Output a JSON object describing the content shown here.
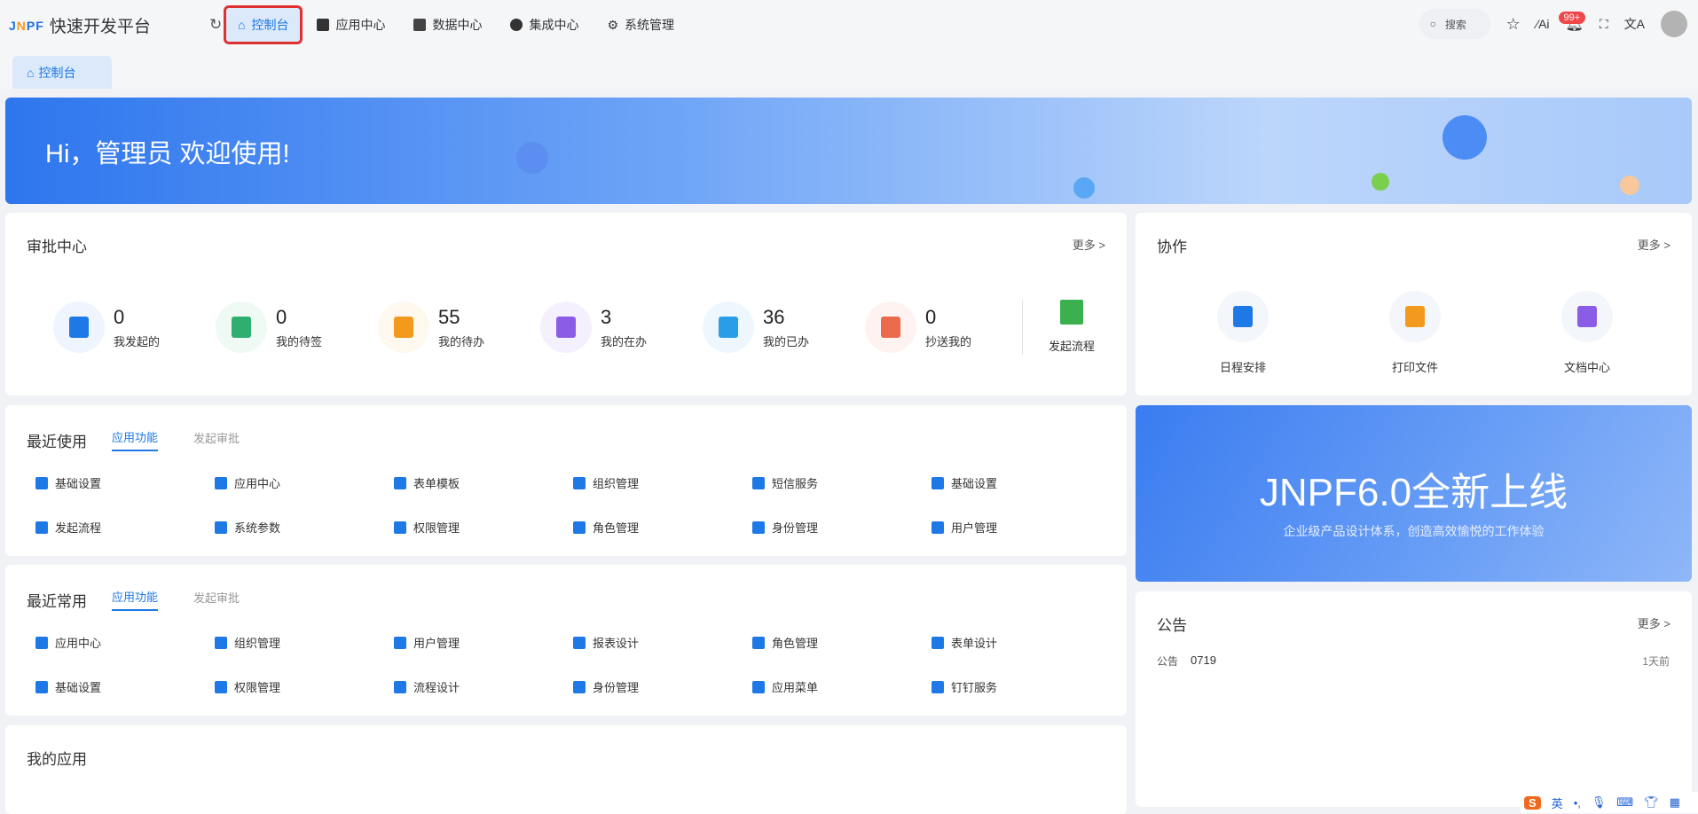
{
  "header": {
    "logo_mark": "JNPF",
    "title": "快速开发平台",
    "nav": [
      {
        "label": "控制台",
        "icon": "home-icon"
      },
      {
        "label": "应用中心",
        "icon": "grid-icon"
      },
      {
        "label": "数据中心",
        "icon": "database-icon"
      },
      {
        "label": "集成中心",
        "icon": "integration-icon"
      },
      {
        "label": "系统管理",
        "icon": "gear-icon"
      }
    ],
    "search_placeholder": "搜索",
    "badge": "99+"
  },
  "tabs": [
    {
      "label": "控制台"
    }
  ],
  "banner": {
    "greeting": "Hi，管理员 欢迎使用!"
  },
  "approval": {
    "title": "审批中心",
    "more": "更多 >",
    "stats": [
      {
        "value": "0",
        "label": "我发起的",
        "color": "#1e78e6",
        "bg": "#eef5fe"
      },
      {
        "value": "0",
        "label": "我的待签",
        "color": "#2fae6f",
        "bg": "#eefaf3"
      },
      {
        "value": "55",
        "label": "我的待办",
        "color": "#f39a1e",
        "bg": "#fef8ee"
      },
      {
        "value": "3",
        "label": "我的在办",
        "color": "#8b5ce6",
        "bg": "#f5f0fe"
      },
      {
        "value": "36",
        "label": "我的已办",
        "color": "#2a9de9",
        "bg": "#eef7fe"
      },
      {
        "value": "0",
        "label": "抄送我的",
        "color": "#ec6a4c",
        "bg": "#fef3f0"
      }
    ],
    "start_flow": "发起流程"
  },
  "coop": {
    "title": "协作",
    "more": "更多 >",
    "items": [
      {
        "label": "日程安排",
        "color": "#1e78e6"
      },
      {
        "label": "打印文件",
        "color": "#f39a1e"
      },
      {
        "label": "文档中心",
        "color": "#8b5ce6"
      }
    ]
  },
  "recent_use": {
    "title": "最近使用",
    "tab_active": "应用功能",
    "tab_other": "发起审批",
    "items": [
      "基础设置",
      "应用中心",
      "表单模板",
      "组织管理",
      "短信服务",
      "基础设置",
      "发起流程",
      "系统参数",
      "权限管理",
      "角色管理",
      "身份管理",
      "用户管理"
    ]
  },
  "frequent": {
    "title": "最近常用",
    "tab_active": "应用功能",
    "tab_other": "发起审批",
    "items": [
      "应用中心",
      "组织管理",
      "用户管理",
      "报表设计",
      "角色管理",
      "表单设计",
      "基础设置",
      "权限管理",
      "流程设计",
      "身份管理",
      "应用菜单",
      "钉钉服务"
    ]
  },
  "promo": {
    "title": "JNPF6.0全新上线",
    "subtitle": "企业级产品设计体系，创造高效愉悦的工作体验"
  },
  "notice": {
    "title": "公告",
    "more": "更多 >",
    "items": [
      {
        "tag": "公告",
        "text": "0719",
        "time": "1天前"
      }
    ]
  },
  "my_apps": {
    "title": "我的应用"
  },
  "tray": {
    "ime": "英",
    "punct": "•,"
  }
}
